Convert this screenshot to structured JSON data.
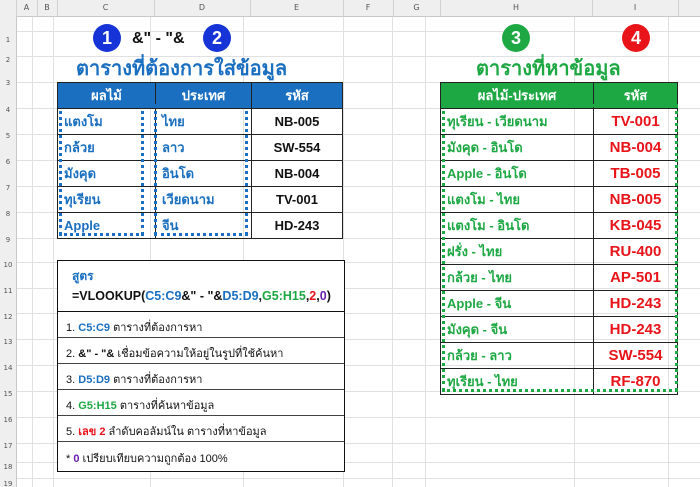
{
  "columns": [
    "A",
    "B",
    "C",
    "D",
    "E",
    "F",
    "G",
    "H",
    "I"
  ],
  "rows": [
    "1",
    "2",
    "3",
    "4",
    "5",
    "6",
    "7",
    "8",
    "9",
    "10",
    "11",
    "12",
    "13",
    "14",
    "15",
    "16",
    "17",
    "18",
    "19"
  ],
  "badges": {
    "one": "1",
    "two": "2",
    "three": "3",
    "four": "4"
  },
  "concat_label": "&\" - \"&",
  "left_title": "ตารางที่ต้องการใส่ข้อมูล",
  "right_title": "ตารางที่หาข้อมูล",
  "left_table": {
    "headers": [
      "ผลไม้",
      "ประเทศ",
      "รหัส"
    ],
    "rows": [
      [
        "แตงโม",
        "ไทย",
        "NB-005"
      ],
      [
        "กล้วย",
        "ลาว",
        "SW-554"
      ],
      [
        "มังคุด",
        "อินโด",
        "NB-004"
      ],
      [
        "ทุเรียน",
        "เวียดนาม",
        "TV-001"
      ],
      [
        "Apple",
        "จีน",
        "HD-243"
      ]
    ]
  },
  "right_table": {
    "headers": [
      "ผลไม้-ประเทศ",
      "รหัส"
    ],
    "rows": [
      [
        "ทุเรียน - เวียดนาม",
        "TV-001"
      ],
      [
        "มังคุด - อินโด",
        "NB-004"
      ],
      [
        "Apple - อินโด",
        "TB-005"
      ],
      [
        "แตงโม - ไทย",
        "NB-005"
      ],
      [
        "แตงโม - อินโด",
        "KB-045"
      ],
      [
        "ฝรั่ง - ไทย",
        "RU-400"
      ],
      [
        "กล้วย - ไทย",
        "AP-501"
      ],
      [
        "Apple - จีน",
        "HD-243"
      ],
      [
        "มังคุด - จีน",
        "HD-243"
      ],
      [
        "กล้วย - ลาว",
        "SW-554"
      ],
      [
        "ทุเรียน - ไทย",
        "RF-870"
      ]
    ]
  },
  "formula_box": {
    "label": "สูตร",
    "f_prefix": "=VLOOKUP(",
    "f_c5c9": "C5:C9",
    "f_concat": "&\" - \"&",
    "f_d5d9": "D5:D9",
    "f_comma1": ",",
    "f_g5h15": "G5:H15",
    "f_comma2": ",",
    "f_two": "2",
    "f_comma3": ",",
    "f_zero": "0",
    "f_close": ")",
    "notes": [
      {
        "num": "1.",
        "key": "C5:C9",
        "text": " ตารางที่ต้องการหา"
      },
      {
        "num": "2.",
        "key": "&\" - \"&",
        "text": " เชื่อมข้อความให้อยู่ในรูปที่ใช้ค้นหา"
      },
      {
        "num": "3.",
        "key": "D5:D9",
        "text": " ตารางที่ต้องการหา"
      },
      {
        "num": "4.",
        "key": "G5:H15",
        "text": " ตารางที่ค้นหาข้อมูล"
      },
      {
        "num": "5.",
        "key": "เลข 2",
        "text": " ลำดับคอลัมน์ใน ตารางที่หาข้อมูล"
      },
      {
        "num": "*",
        "key": "0",
        "text": " เปรียบเทียบความถูกต้อง 100%"
      }
    ]
  },
  "colors": {
    "header_blue": "#1b6fc0",
    "header_green": "#1ea844",
    "key_blue": "#1b6fc0",
    "key_green": "#1ea844",
    "key_red": "#e8141a",
    "key_purple": "#6a1fb0"
  }
}
